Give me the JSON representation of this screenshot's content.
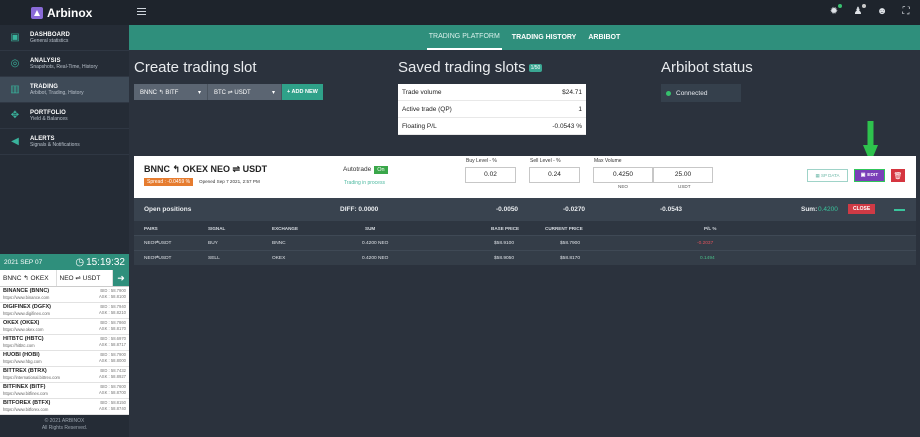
{
  "brand": {
    "name": "Arbinox"
  },
  "sidebar": {
    "items": [
      {
        "title": "DASHBOARD",
        "subtitle": "General statistics",
        "icon": "dashboard-icon"
      },
      {
        "title": "ANALYSIS",
        "subtitle": "Snapshots, Real-Time, History",
        "icon": "globe-icon"
      },
      {
        "title": "TRADING",
        "subtitle": "Arbibot, Trading, History",
        "icon": "chart-icon"
      },
      {
        "title": "PORTFOLIO",
        "subtitle": "Yield & Balances",
        "icon": "handshake-icon"
      },
      {
        "title": "ALERTS",
        "subtitle": "Signals & Notifications",
        "icon": "megaphone-icon"
      }
    ],
    "ticker": {
      "date": "2021 SEP 07",
      "time": "15:19:32",
      "pair_left": "BNNC ↰ OKEX",
      "pair_right": "NEO ⇌ USDT",
      "exchanges": [
        {
          "name": "BINANCE (BNNC)",
          "url": "https://www.binance.com",
          "bid": "BID : 58.7900",
          "ask": "ASK : 58.8100"
        },
        {
          "name": "DIGIFINEX (DGFX)",
          "url": "https://www.digifinex.com",
          "bid": "BID : 58.7940",
          "ask": "ASK : 58.8210"
        },
        {
          "name": "OKEX (OKEX)",
          "url": "https://www.okex.com",
          "bid": "BID : 58.7860",
          "ask": "ASK : 58.8170"
        },
        {
          "name": "HITBTC (HBTC)",
          "url": "https://hitbtc.com",
          "bid": "BID : 58.6970",
          "ask": "ASK : 58.8717"
        },
        {
          "name": "HUOBI (HOBI)",
          "url": "https://www.hbg.com",
          "bid": "BID : 58.7900",
          "ask": "ASK : 58.8000"
        },
        {
          "name": "BITTREX (BTRX)",
          "url": "https://international.bittrex.com",
          "bid": "BID : 58.7432",
          "ask": "ASK : 58.8927"
        },
        {
          "name": "BITFINEX (BITF)",
          "url": "https://www.bitfinex.com",
          "bid": "BID : 58.7600",
          "ask": "ASK : 58.8700"
        },
        {
          "name": "BITFOREX (BTFX)",
          "url": "https://www.bitforex.com",
          "bid": "BID : 58.8150",
          "ask": "ASK : 58.8740"
        }
      ]
    },
    "footer": {
      "line1": "© 2021 ARBINOX",
      "line2": "All Rights Reserved."
    }
  },
  "tabs": [
    "TRADING PLATFORM",
    "TRADING HISTORY",
    "ARBIBOT"
  ],
  "create": {
    "title": "Create trading slot",
    "exchange": "BNNC ↰ BITF",
    "pair": "BTC ⇌ USDT",
    "add_label": "+ ADD NEW"
  },
  "saved": {
    "title": "Saved trading slots",
    "badge": "1/50",
    "rows": [
      {
        "label": "Trade volume",
        "value": "$24.71"
      },
      {
        "label": "Active trade (QP)",
        "value": "1"
      },
      {
        "label": "Floating P/L",
        "value": "-0.0543 %"
      }
    ]
  },
  "arbibot": {
    "title": "Arbibot status",
    "status": "Connected"
  },
  "slot": {
    "title": "BNNC ↰ OKEX  NEO ⇌ USDT",
    "spread": "Spread : -0.0459 %",
    "opened": "Opened Sep 7 2021, 2:57 PM",
    "autotrade_label": "Autotrade",
    "autotrade_state": "On",
    "in_process": "Trading in process",
    "buy_label": "Buy Level - %",
    "buy_value": "0.02",
    "sell_label": "Sell Level - %",
    "sell_value": "0.24",
    "max_label": "Max Volume",
    "max_neo": "0.4250",
    "max_usdt": "25.00",
    "neo_label": "NEO",
    "usdt_label": "USDT",
    "sp_data": "SP DATA",
    "edit": "EDIT",
    "accent": "#7a3fb8"
  },
  "positions": {
    "title": "Open positions",
    "diff": "DIFF: 0.0000",
    "v1": "-0.0050",
    "v2": "-0.0270",
    "v3": "-0.0543",
    "sum_label": "Sum:",
    "sum_value": "0.4200",
    "close": "CLOSE",
    "headers": [
      "PAIRS",
      "SIGNAL",
      "EXCHANGE",
      "SUM",
      "BASE PRICE",
      "CURRENT PRICE",
      "P/L %"
    ],
    "rows": [
      {
        "pair": "NEO⇌USDT",
        "signal": "BUY",
        "exchange": "BNNC",
        "sum": "0.4200 NEO",
        "base": "$58.9100",
        "current": "$58.7900",
        "pl": "-0.2037"
      },
      {
        "pair": "NEO⇌USDT",
        "signal": "SELL",
        "exchange": "OKEX",
        "sum": "0.4200 NEO",
        "base": "$58.9050",
        "current": "$58.8170",
        "pl": "0.1494"
      }
    ]
  },
  "colors": {
    "teal": "#2f8f7c",
    "red": "#cf3a45",
    "green": "#36c06d",
    "orange": "#e67c2f"
  }
}
